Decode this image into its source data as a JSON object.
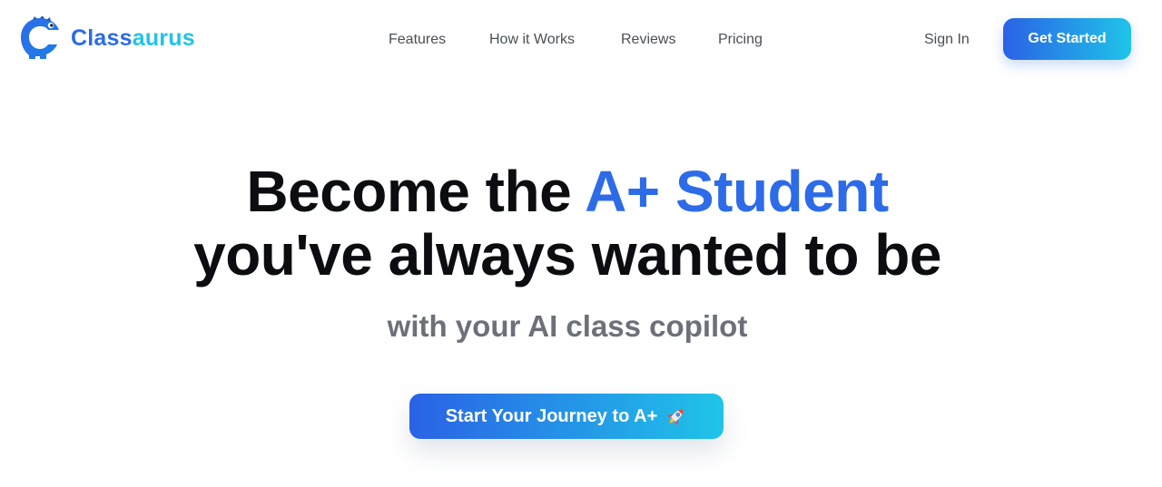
{
  "brand": {
    "name_part1": "Class",
    "name_part2": "aurus",
    "logo_icon": "dinosaur-logo-icon",
    "colors": {
      "primary": "#2d6be8",
      "secondary": "#22c3e6"
    }
  },
  "nav": {
    "items": [
      {
        "label": "Features"
      },
      {
        "label": "How it Works"
      },
      {
        "label": "Reviews"
      },
      {
        "label": "Pricing"
      }
    ],
    "sign_in": "Sign In",
    "get_started": "Get Started"
  },
  "hero": {
    "title_part1": "Become the ",
    "title_accent": "A+ Student",
    "title_line2": "you've always wanted to be",
    "subtitle": "with your AI class copilot",
    "cta_label": "Start Your Journey to A+",
    "cta_icon": "rocket-icon"
  },
  "theme": {
    "gradient_start": "#2a62e6",
    "gradient_end": "#1fc4e8",
    "heading_color": "#0c0d10",
    "subtitle_color": "#6c7078",
    "nav_color": "#4a4f57"
  }
}
